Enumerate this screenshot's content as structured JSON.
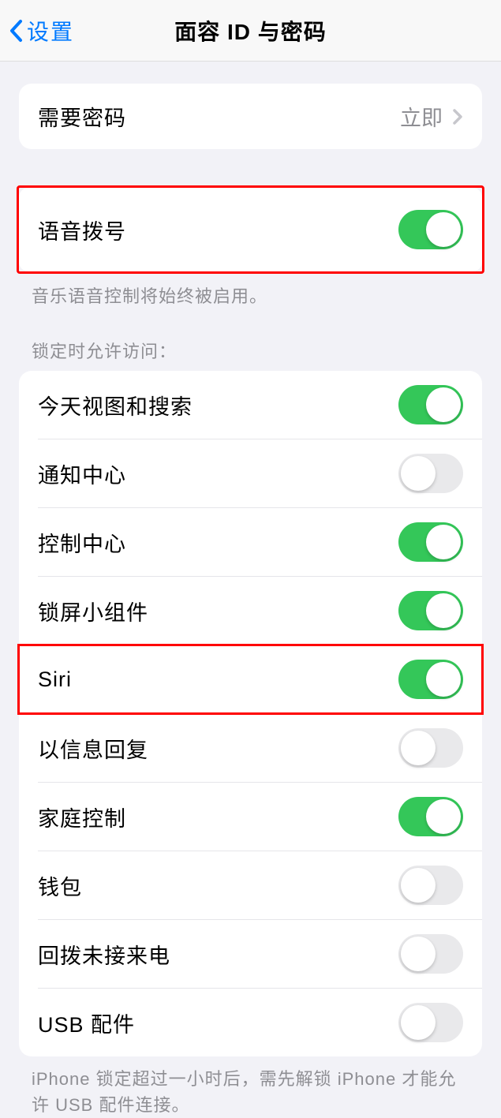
{
  "nav": {
    "back_label": "设置",
    "title": "面容 ID 与密码"
  },
  "passcode_group": {
    "label": "需要密码",
    "value": "立即"
  },
  "voice_dial": {
    "label": "语音拨号",
    "on": true,
    "footer": "音乐语音控制将始终被启用。"
  },
  "lock_access": {
    "header": "锁定时允许访问：",
    "items": [
      {
        "label": "今天视图和搜索",
        "on": true
      },
      {
        "label": "通知中心",
        "on": false
      },
      {
        "label": "控制中心",
        "on": true
      },
      {
        "label": "锁屏小组件",
        "on": true
      },
      {
        "label": "Siri",
        "on": true
      },
      {
        "label": "以信息回复",
        "on": false
      },
      {
        "label": "家庭控制",
        "on": true
      },
      {
        "label": "钱包",
        "on": false
      },
      {
        "label": "回拨未接来电",
        "on": false
      },
      {
        "label": "USB 配件",
        "on": false
      }
    ],
    "footer": "iPhone 锁定超过一小时后，需先解锁 iPhone 才能允许 USB 配件连接。"
  }
}
